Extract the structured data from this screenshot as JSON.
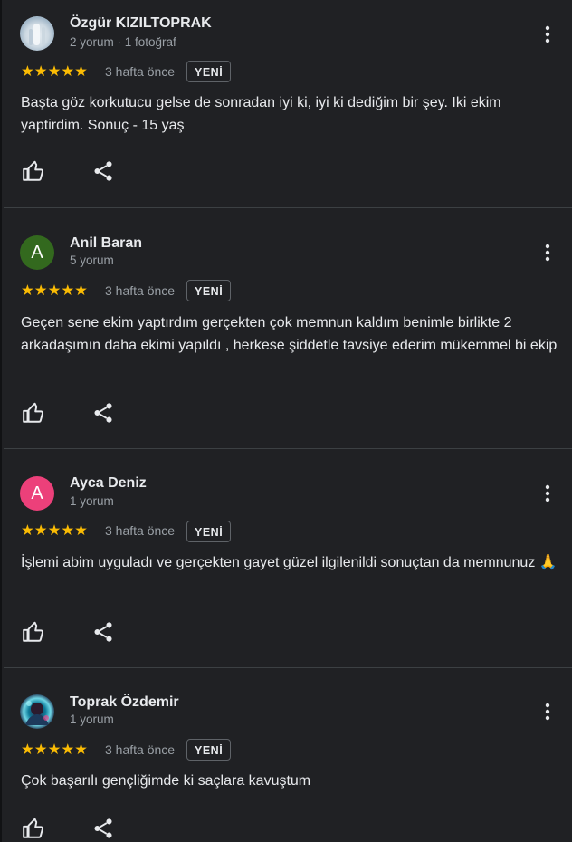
{
  "reviews": [
    {
      "name": "Özgür KIZILTOPRAK",
      "meta": "2 yorum · 1 fotoğraf",
      "avatar_letter": "",
      "avatar_color": "",
      "stars": "★★★★★",
      "rating": 5,
      "time": "3 hafta önce",
      "badge": "YENİ",
      "text": "Başta göz korkutucu gelse de sonradan iyi ki, iyi ki dediğim bir şey. Iki ekim yaptirdim. Sonuç - 15 yaş"
    },
    {
      "name": "Anil Baran",
      "meta": "5 yorum",
      "avatar_letter": "A",
      "avatar_color": "#33691e",
      "stars": "★★★★★",
      "rating": 5,
      "time": "3 hafta önce",
      "badge": "YENİ",
      "text": "Geçen sene ekim yaptırdım gerçekten çok memnun kaldım benimle birlikte 2 arkadaşımın daha ekimi yapıldı , herkese şiddetle tavsiye ederim mükemmel bi ekip"
    },
    {
      "name": "Ayca Deniz",
      "meta": "1 yorum",
      "avatar_letter": "A",
      "avatar_color": "#ec407a",
      "stars": "★★★★★",
      "rating": 5,
      "time": "3 hafta önce",
      "badge": "YENİ",
      "text": "İşlemi abim uyguladı ve gerçekten gayet güzel ilgilenildi sonuçtan da memnunuz 🙏"
    },
    {
      "name": "Toprak Özdemir",
      "meta": "1 yorum",
      "avatar_letter": "",
      "avatar_color": "",
      "stars": "★★★★★",
      "rating": 5,
      "time": "3 hafta önce",
      "badge": "YENİ",
      "text": "Çok başarılı gençliğimde ki saçlara kavuştum"
    }
  ],
  "colors": {
    "background": "#202124",
    "star": "#fbbc04",
    "text": "#e8eaed",
    "muted": "#9aa0a6",
    "divider": "#3c4043"
  },
  "icons": {
    "more": "more-vert-icon",
    "like": "thumb-up-icon",
    "share": "share-icon"
  }
}
